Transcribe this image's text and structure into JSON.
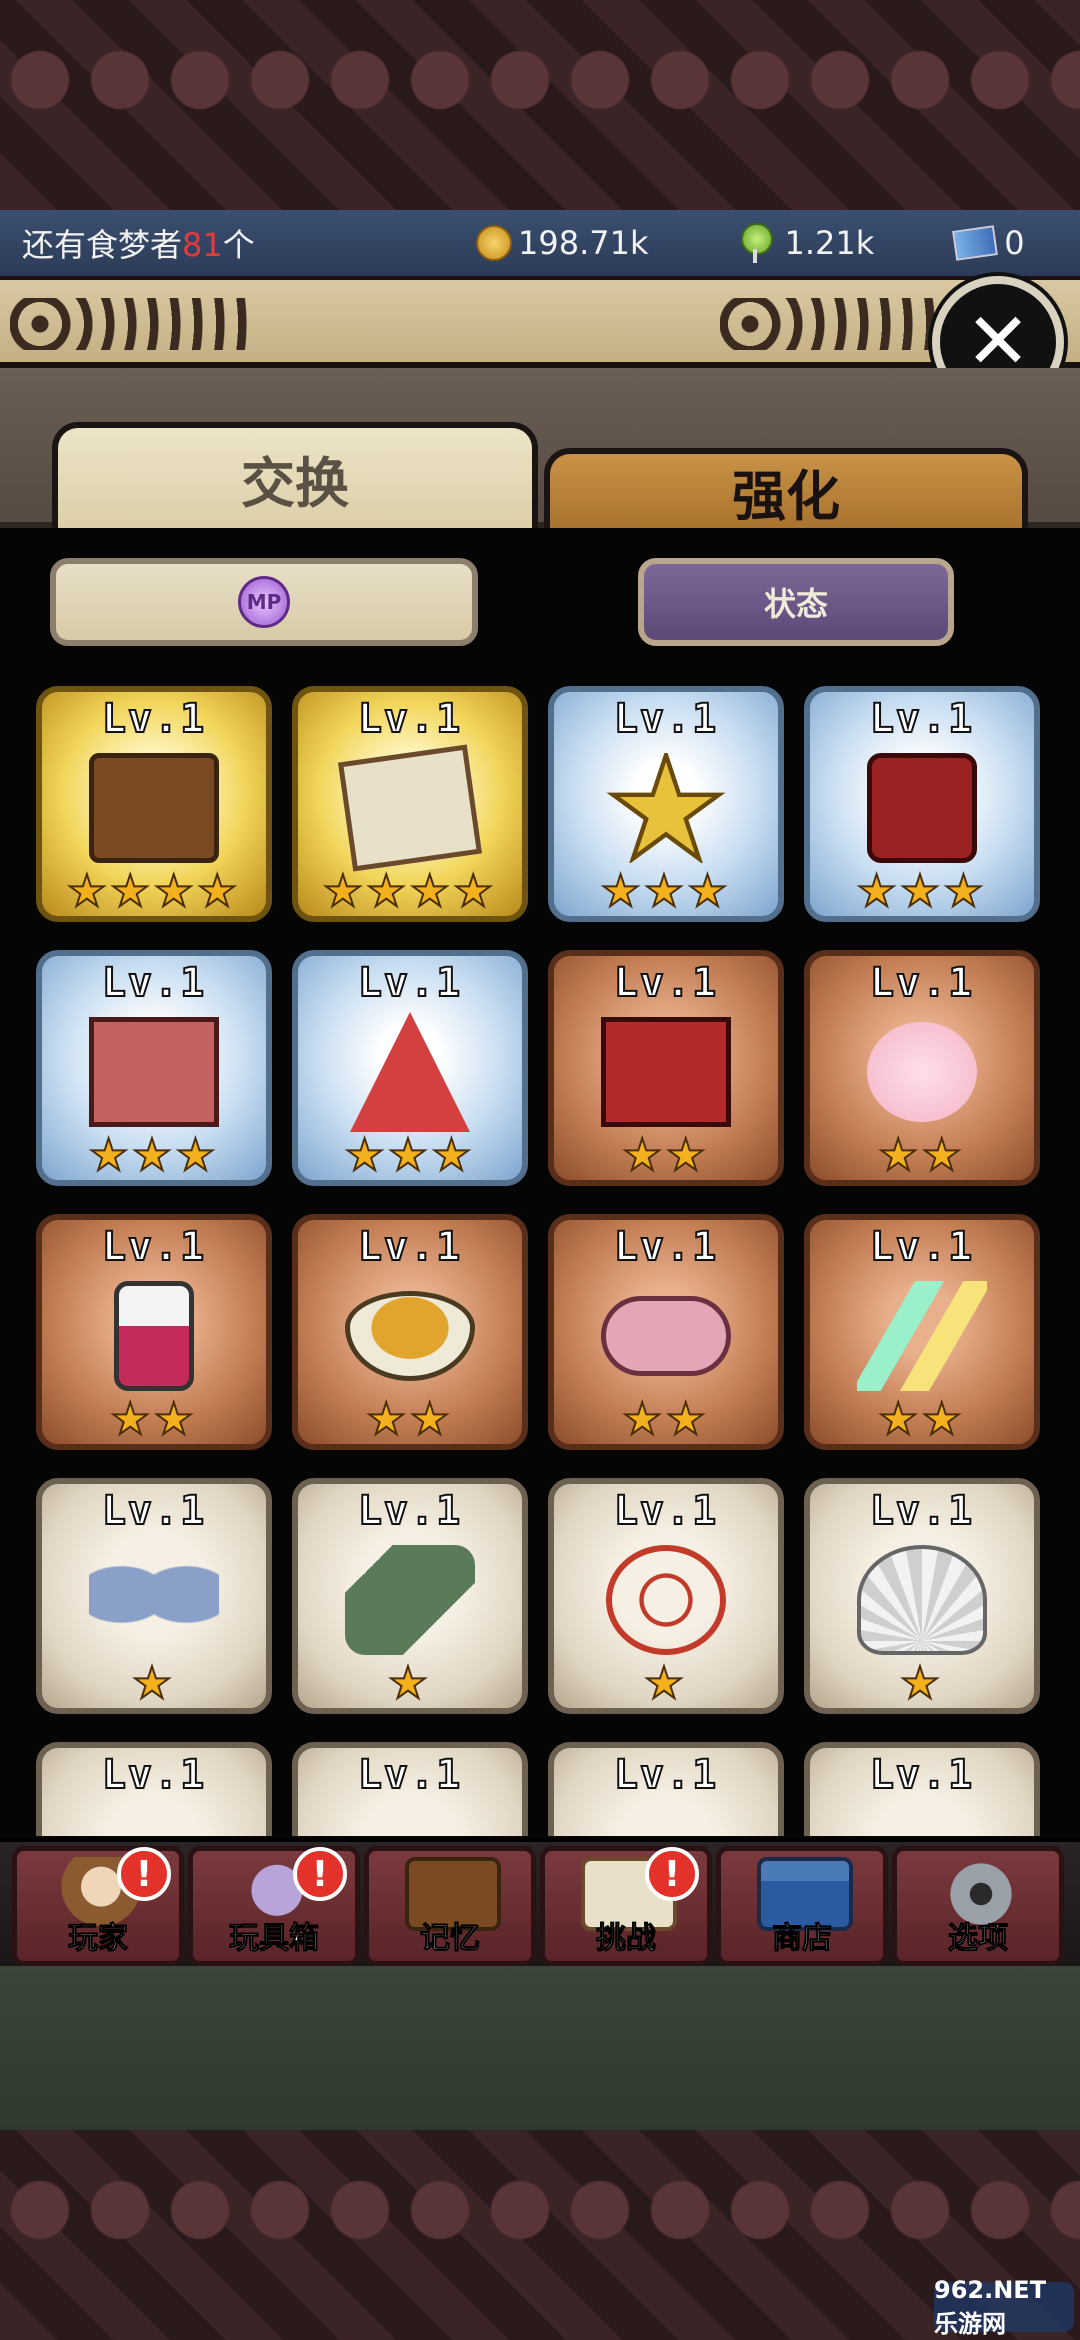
{
  "status_bar": {
    "dreamers_prefix": "还有食梦者",
    "dreamers_count": "81",
    "dreamers_suffix": "个",
    "coins": "198.71k",
    "candy": "1.21k",
    "tickets": "0",
    "icons": {
      "coins": "coin-icon",
      "candy": "lollipop-icon",
      "tickets": "ticket-icon"
    }
  },
  "close_button": {
    "label": "✕",
    "icon": "close-icon"
  },
  "tabs": [
    {
      "label": "交换",
      "selected": true
    },
    {
      "label": "强化",
      "selected": false
    }
  ],
  "filters": {
    "mp_label": "MP",
    "status_label": "状态"
  },
  "items": [
    {
      "level": "Lv.1",
      "stars": "★★★★",
      "rarity": 4,
      "icon": "music-box-icon"
    },
    {
      "level": "Lv.1",
      "stars": "★★★★",
      "rarity": 4,
      "icon": "clipboard-icon"
    },
    {
      "level": "Lv.1",
      "stars": "★★★",
      "rarity": 3,
      "icon": "star-topper-icon"
    },
    {
      "level": "Lv.1",
      "stars": "★★★",
      "rarity": 3,
      "icon": "dice-icon"
    },
    {
      "level": "Lv.1",
      "stars": "★★★",
      "rarity": 3,
      "icon": "bear-book-icon"
    },
    {
      "level": "Lv.1",
      "stars": "★★★",
      "rarity": 3,
      "icon": "party-hat-icon"
    },
    {
      "level": "Lv.1",
      "stars": "★★",
      "rarity": 2,
      "icon": "christmas-card-icon"
    },
    {
      "level": "Lv.1",
      "stars": "★★",
      "rarity": 2,
      "icon": "cotton-candy-icon"
    },
    {
      "level": "Lv.1",
      "stars": "★★",
      "rarity": 2,
      "icon": "bottle-icon"
    },
    {
      "level": "Lv.1",
      "stars": "★★",
      "rarity": 2,
      "icon": "cookie-bowl-icon"
    },
    {
      "level": "Lv.1",
      "stars": "★★",
      "rarity": 2,
      "icon": "bunny-slippers-icon"
    },
    {
      "level": "Lv.1",
      "stars": "★★",
      "rarity": 2,
      "icon": "glow-sticks-icon"
    },
    {
      "level": "Lv.1",
      "stars": "★",
      "rarity": 1,
      "icon": "ribbon-bow-icon"
    },
    {
      "level": "Lv.1",
      "stars": "★",
      "rarity": 1,
      "icon": "syringe-icon"
    },
    {
      "level": "Lv.1",
      "stars": "★",
      "rarity": 1,
      "icon": "swirl-icon"
    },
    {
      "level": "Lv.1",
      "stars": "★",
      "rarity": 1,
      "icon": "seashell-icon"
    },
    {
      "level": "Lv.1",
      "stars": "",
      "rarity": 1,
      "icon": "cat-plush-icon"
    },
    {
      "level": "Lv.1",
      "stars": "",
      "rarity": 1,
      "icon": "umbrella-icon"
    },
    {
      "level": "Lv.1",
      "stars": "",
      "rarity": 1,
      "icon": "bird-toy-icon"
    },
    {
      "level": "Lv.1",
      "stars": "",
      "rarity": 1,
      "icon": "smiley-ball-icon"
    }
  ],
  "nav": [
    {
      "label": "玩家",
      "alert": "!",
      "icon": "player-icon"
    },
    {
      "label": "玩具箱",
      "alert": "!",
      "icon": "toybox-icon"
    },
    {
      "label": "记忆",
      "alert": "",
      "icon": "memory-box-icon"
    },
    {
      "label": "挑战",
      "alert": "!",
      "icon": "challenge-icon"
    },
    {
      "label": "商店",
      "alert": "",
      "icon": "shop-basket-icon"
    },
    {
      "label": "选项",
      "alert": "",
      "icon": "gear-icon"
    }
  ],
  "watermark": "962.NET 乐游网"
}
